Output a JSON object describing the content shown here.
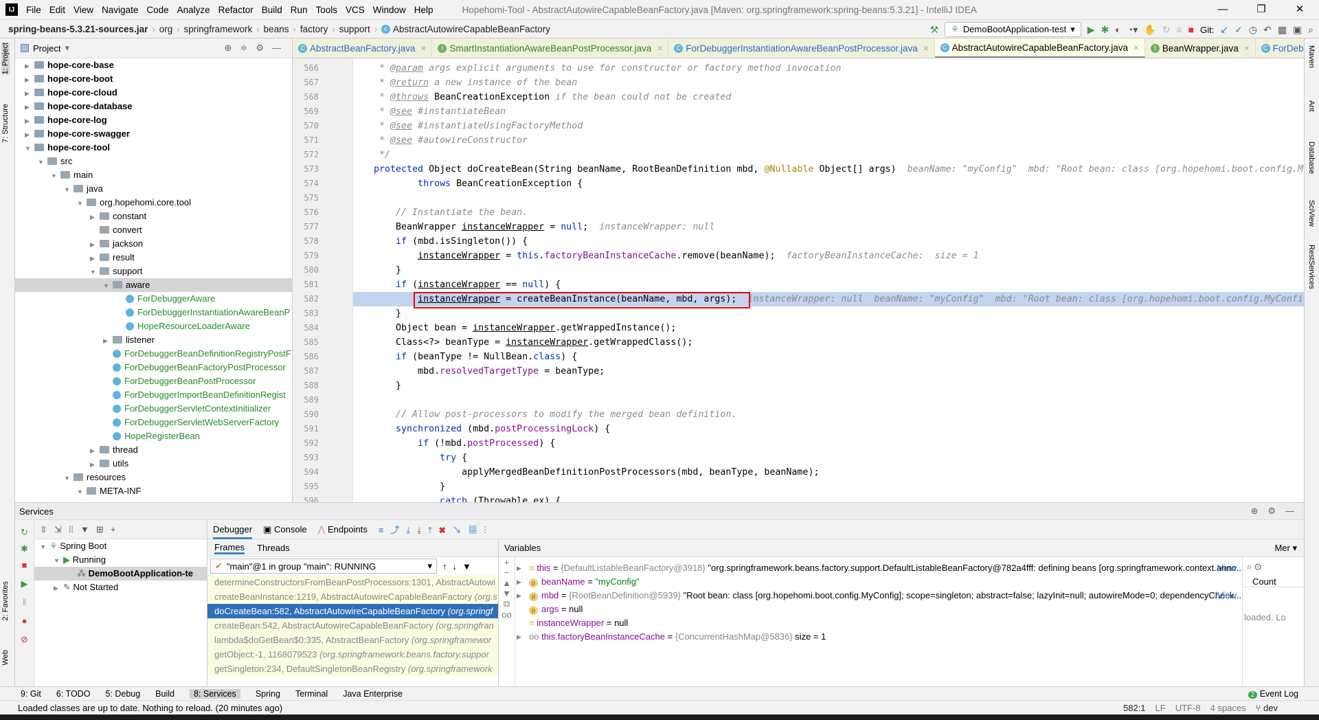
{
  "menubar": {
    "items": [
      "File",
      "Edit",
      "View",
      "Navigate",
      "Code",
      "Analyze",
      "Refactor",
      "Build",
      "Run",
      "Tools",
      "VCS",
      "Window",
      "Help"
    ],
    "title": "Hopehomi-Tool - AbstractAutowireCapableBeanFactory.java [Maven: org.springframework:spring-beans:5.3.21] - IntelliJ IDEA"
  },
  "breadcrumb": [
    "spring-beans-5.3.21-sources.jar",
    "org",
    "springframework",
    "beans",
    "factory",
    "support",
    "AbstractAutowireCapableBeanFactory"
  ],
  "run_config": "DemoBootApplication-test",
  "git_label": "Git:",
  "left_strip": [
    "1: Project",
    "7: Structure",
    "2: Favorites",
    "Web"
  ],
  "right_strip": [
    "Maven",
    "Ant",
    "Database",
    "SciView",
    "RestServices"
  ],
  "project": {
    "title": "Project",
    "tree": [
      {
        "label": "hope-core-base",
        "lvl": 0,
        "kind": "mod",
        "arrow": "▶"
      },
      {
        "label": "hope-core-boot",
        "lvl": 0,
        "kind": "mod",
        "arrow": "▶"
      },
      {
        "label": "hope-core-cloud",
        "lvl": 0,
        "kind": "mod",
        "arrow": "▶"
      },
      {
        "label": "hope-core-database",
        "lvl": 0,
        "kind": "mod",
        "arrow": "▶"
      },
      {
        "label": "hope-core-log",
        "lvl": 0,
        "kind": "mod",
        "arrow": "▶"
      },
      {
        "label": "hope-core-swagger",
        "lvl": 0,
        "kind": "mod",
        "arrow": "▶"
      },
      {
        "label": "hope-core-tool",
        "lvl": 0,
        "kind": "mod",
        "arrow": "▼"
      },
      {
        "label": "src",
        "lvl": 1,
        "kind": "folder",
        "arrow": "▼"
      },
      {
        "label": "main",
        "lvl": 2,
        "kind": "folder",
        "arrow": "▼"
      },
      {
        "label": "java",
        "lvl": 3,
        "kind": "folder",
        "arrow": "▼"
      },
      {
        "label": "org.hopehomi.core.tool",
        "lvl": 4,
        "kind": "folder",
        "arrow": "▼"
      },
      {
        "label": "constant",
        "lvl": 5,
        "kind": "folder",
        "arrow": "▶"
      },
      {
        "label": "convert",
        "lvl": 5,
        "kind": "folder",
        "arrow": ""
      },
      {
        "label": "jackson",
        "lvl": 5,
        "kind": "folder",
        "arrow": "▶"
      },
      {
        "label": "result",
        "lvl": 5,
        "kind": "folder",
        "arrow": "▶"
      },
      {
        "label": "support",
        "lvl": 5,
        "kind": "folder",
        "arrow": "▼"
      },
      {
        "label": "aware",
        "lvl": 6,
        "kind": "folder",
        "arrow": "▼",
        "selected": true
      },
      {
        "label": "ForDebuggerAware",
        "lvl": 7,
        "kind": "class",
        "arrow": ""
      },
      {
        "label": "ForDebuggerInstantiationAwareBeanP",
        "lvl": 7,
        "kind": "class",
        "arrow": ""
      },
      {
        "label": "HopeResourceLoaderAware",
        "lvl": 7,
        "kind": "class",
        "arrow": ""
      },
      {
        "label": "listener",
        "lvl": 6,
        "kind": "folder",
        "arrow": "▶"
      },
      {
        "label": "ForDebuggerBeanDefinitionRegistryPostF",
        "lvl": 6,
        "kind": "class",
        "arrow": ""
      },
      {
        "label": "ForDebuggerBeanFactoryPostProcessor",
        "lvl": 6,
        "kind": "class",
        "arrow": ""
      },
      {
        "label": "ForDebuggerBeanPostProcessor",
        "lvl": 6,
        "kind": "class",
        "arrow": ""
      },
      {
        "label": "ForDebuggerImportBeanDefinitionRegist",
        "lvl": 6,
        "kind": "class",
        "arrow": ""
      },
      {
        "label": "ForDebuggerServletContextInitializer",
        "lvl": 6,
        "kind": "class",
        "arrow": ""
      },
      {
        "label": "ForDebuggerServletWebServerFactory",
        "lvl": 6,
        "kind": "class",
        "arrow": ""
      },
      {
        "label": "HopeRegisterBean",
        "lvl": 6,
        "kind": "class",
        "arrow": ""
      },
      {
        "label": "thread",
        "lvl": 5,
        "kind": "folder",
        "arrow": "▶"
      },
      {
        "label": "utils",
        "lvl": 5,
        "kind": "folder",
        "arrow": "▶"
      },
      {
        "label": "resources",
        "lvl": 3,
        "kind": "folder",
        "arrow": "▼"
      },
      {
        "label": "META-INF",
        "lvl": 4,
        "kind": "folder",
        "arrow": "▼"
      }
    ]
  },
  "tabs": [
    {
      "label": "AbstractBeanFactory.java",
      "icon": "C",
      "color": "blue"
    },
    {
      "label": "SmartInstantiationAwareBeanPostProcessor.java",
      "icon": "I",
      "color": "green"
    },
    {
      "label": "ForDebuggerInstantiationAwareBeanPostProcessor.java",
      "icon": "C",
      "color": "blue"
    },
    {
      "label": "AbstractAutowireCapableBeanFactory.java",
      "icon": "C",
      "active": true
    },
    {
      "label": "BeanWrapper.java",
      "icon": "I"
    },
    {
      "label": "ForDebugge",
      "icon": "C",
      "color": "blue"
    }
  ],
  "editor": {
    "lines": [
      {
        "n": 566,
        "tokens": [
          [
            "    * ",
            "c"
          ],
          [
            "@param",
            "t"
          ],
          [
            " args explicit arguments to use for constructor or factory method invocation",
            "c"
          ]
        ]
      },
      {
        "n": 567,
        "tokens": [
          [
            "    * ",
            "c"
          ],
          [
            "@return",
            "t"
          ],
          [
            " a new instance of the bean",
            "c"
          ]
        ]
      },
      {
        "n": 568,
        "tokens": [
          [
            "    * ",
            "c"
          ],
          [
            "@throws",
            "t"
          ],
          [
            " BeanCreationException",
            "p"
          ],
          [
            " if the bean could not be created",
            "c"
          ]
        ]
      },
      {
        "n": 569,
        "tokens": [
          [
            "    * ",
            "c"
          ],
          [
            "@see",
            "t"
          ],
          [
            " #instantiateBean",
            "c"
          ]
        ]
      },
      {
        "n": 570,
        "tokens": [
          [
            "    * ",
            "c"
          ],
          [
            "@see",
            "t"
          ],
          [
            " #instantiateUsingFactoryMethod",
            "c"
          ]
        ]
      },
      {
        "n": 571,
        "tokens": [
          [
            "    * ",
            "c"
          ],
          [
            "@see",
            "t"
          ],
          [
            " #autowireConstructor",
            "c"
          ]
        ]
      },
      {
        "n": 572,
        "tokens": [
          [
            "    */",
            "c"
          ]
        ]
      },
      {
        "n": 573,
        "tokens": [
          [
            "   protected ",
            "k"
          ],
          [
            "Object ",
            "p"
          ],
          [
            "doCreateBean",
            "p"
          ],
          [
            "(String beanName, RootBeanDefinition mbd, ",
            "p"
          ],
          [
            "@Nullable",
            "a"
          ],
          [
            " Object[] args)",
            "p"
          ],
          [
            "  beanName: \"myConfig\"  mbd: \"Root bean: class [org.hopehomi.boot.config.M",
            "h"
          ]
        ]
      },
      {
        "n": 574,
        "tokens": [
          [
            "           throws ",
            "k"
          ],
          [
            "BeanCreationException {",
            "p"
          ]
        ]
      },
      {
        "n": 575,
        "tokens": []
      },
      {
        "n": 576,
        "tokens": [
          [
            "       // Instantiate the bean.",
            "c"
          ]
        ]
      },
      {
        "n": 577,
        "tokens": [
          [
            "       BeanWrapper ",
            "p"
          ],
          [
            "instanceWrapper",
            "u"
          ],
          [
            " = ",
            "p"
          ],
          [
            "null",
            "k"
          ],
          [
            ";",
            "p"
          ],
          [
            "  instanceWrapper: null",
            "h"
          ]
        ]
      },
      {
        "n": 578,
        "tokens": [
          [
            "       ",
            "p"
          ],
          [
            "if ",
            "k"
          ],
          [
            "(mbd.isSingleton()) {",
            "p"
          ]
        ]
      },
      {
        "n": 579,
        "tokens": [
          [
            "           ",
            "p"
          ],
          [
            "instanceWrapper",
            "u"
          ],
          [
            " = ",
            "p"
          ],
          [
            "this",
            "k"
          ],
          [
            ".",
            "p"
          ],
          [
            "factoryBeanInstanceCache",
            "f"
          ],
          [
            ".remove(beanName);",
            "p"
          ],
          [
            "  factoryBeanInstanceCache:  size = 1",
            "h"
          ]
        ]
      },
      {
        "n": 580,
        "tokens": [
          [
            "       }",
            "p"
          ]
        ]
      },
      {
        "n": 581,
        "tokens": [
          [
            "       ",
            "p"
          ],
          [
            "if ",
            "k"
          ],
          [
            "(",
            "p"
          ],
          [
            "instanceWrapper",
            "u"
          ],
          [
            " == ",
            "p"
          ],
          [
            "null",
            "k"
          ],
          [
            ") {",
            "p"
          ]
        ]
      },
      {
        "n": 582,
        "hl": true,
        "tokens": [
          [
            "           ",
            "p"
          ],
          [
            "instanceWrapper",
            "u"
          ],
          [
            " = createBeanInstance(beanName, mbd, args);",
            "p"
          ],
          [
            "  instanceWrapper: null  beanName: \"myConfig\"  mbd: \"Root bean: class [org.hopehomi.boot.config.MyConfi",
            "h"
          ]
        ]
      },
      {
        "n": 583,
        "tokens": [
          [
            "       }",
            "p"
          ]
        ]
      },
      {
        "n": 584,
        "tokens": [
          [
            "       Object bean = ",
            "p"
          ],
          [
            "instanceWrapper",
            "u"
          ],
          [
            ".getWrappedInstance();",
            "p"
          ]
        ]
      },
      {
        "n": 585,
        "tokens": [
          [
            "       Class<?> beanType = ",
            "p"
          ],
          [
            "instanceWrapper",
            "u"
          ],
          [
            ".getWrappedClass();",
            "p"
          ]
        ]
      },
      {
        "n": 586,
        "tokens": [
          [
            "       ",
            "p"
          ],
          [
            "if ",
            "k"
          ],
          [
            "(beanType != NullBean.",
            "p"
          ],
          [
            "class",
            "k"
          ],
          [
            ") {",
            "p"
          ]
        ]
      },
      {
        "n": 587,
        "tokens": [
          [
            "           mbd.",
            "p"
          ],
          [
            "resolvedTargetType",
            "f"
          ],
          [
            " = beanType;",
            "p"
          ]
        ]
      },
      {
        "n": 588,
        "tokens": [
          [
            "       }",
            "p"
          ]
        ]
      },
      {
        "n": 589,
        "tokens": []
      },
      {
        "n": 590,
        "tokens": [
          [
            "       // Allow post-processors to modify the merged bean definition.",
            "c"
          ]
        ]
      },
      {
        "n": 591,
        "tokens": [
          [
            "       ",
            "p"
          ],
          [
            "synchronized ",
            "k"
          ],
          [
            "(mbd.",
            "p"
          ],
          [
            "postProcessingLock",
            "f"
          ],
          [
            ") {",
            "p"
          ]
        ]
      },
      {
        "n": 592,
        "tokens": [
          [
            "           ",
            "p"
          ],
          [
            "if ",
            "k"
          ],
          [
            "(!mbd.",
            "p"
          ],
          [
            "postProcessed",
            "f"
          ],
          [
            ") {",
            "p"
          ]
        ]
      },
      {
        "n": 593,
        "tokens": [
          [
            "               ",
            "p"
          ],
          [
            "try ",
            "k"
          ],
          [
            "{",
            "p"
          ]
        ]
      },
      {
        "n": 594,
        "tokens": [
          [
            "                   applyMergedBeanDefinitionPostProcessors(mbd, beanType, beanName);",
            "p"
          ]
        ]
      },
      {
        "n": 595,
        "tokens": [
          [
            "               }",
            "p"
          ]
        ]
      },
      {
        "n": 596,
        "tokens": [
          [
            "               ",
            "p"
          ],
          [
            "catch ",
            "k"
          ],
          [
            "(Throwable ex) {",
            "p"
          ]
        ]
      }
    ]
  },
  "services": {
    "title": "Services",
    "tree": [
      {
        "label": "Spring Boot",
        "lvl": 0,
        "arrow": "▼"
      },
      {
        "label": "Running",
        "lvl": 1,
        "arrow": "▼"
      },
      {
        "label": "DemoBootApplication-te",
        "lvl": 2,
        "arrow": "",
        "selected": true
      },
      {
        "label": "Not Started",
        "lvl": 1,
        "arrow": "▶"
      }
    ]
  },
  "debugger": {
    "tabs": [
      "Debugger",
      "Console",
      "Endpoints"
    ],
    "frames_tabs": [
      "Frames",
      "Threads"
    ],
    "thread": "\"main\"@1 in group \"main\": RUNNING",
    "frames": [
      {
        "m": "determineConstructorsFromBeanPostProcessors:1301, AbstractAutowi",
        "p": ""
      },
      {
        "m": "createBeanInstance:1219, AbstractAutowireCapableBeanFactory ",
        "p": "(org.s"
      },
      {
        "m": "doCreateBean:582, AbstractAutowireCapableBeanFactory ",
        "p": "(org.springf",
        "selected": true
      },
      {
        "m": "createBean:542, AbstractAutowireCapableBeanFactory ",
        "p": "(org.springfran"
      },
      {
        "m": "lambda$doGetBean$0:335, AbstractBeanFactory ",
        "p": "(org.springframewor"
      },
      {
        "m": "getObject:-1, 1168079523 ",
        "p": "(org.springframework.beans.factory.suppor"
      },
      {
        "m": "getSingleton:234, DefaultSingletonBeanRegistry ",
        "p": "(org.springframework"
      }
    ],
    "variables_title": "Variables",
    "mem_label": "Mer",
    "count_label": "Count",
    "loaded_text": "loaded. Lo",
    "variables": [
      {
        "name": "this",
        "type": "{DefaultListableBeanFactory@3918}",
        "val": " \"org.springframework.beans.factory.support.DefaultListableBeanFactory@782a4fff: defining beans [org.springframework.context.anno...",
        "view": "View",
        "icon": "≡",
        "expand": true
      },
      {
        "name": "beanName",
        "type": "",
        "val": "\"myConfig\"",
        "str": true,
        "icon": "p",
        "expand": true
      },
      {
        "name": "mbd",
        "type": "{RootBeanDefinition@5939}",
        "val": " \"Root bean: class [org.hopehomi.boot.config.MyConfig]; scope=singleton; abstract=false; lazyInit=null; autowireMode=0; dependencyCheck...",
        "view": "View",
        "icon": "p",
        "expand": true
      },
      {
        "name": "args",
        "type": "",
        "val": "null",
        "icon": "p"
      },
      {
        "name": "instanceWrapper",
        "type": "",
        "val": "null",
        "icon": "≡"
      },
      {
        "name": "this.factoryBeanInstanceCache",
        "type": "{ConcurrentHashMap@5836}",
        "val": "  size = 1",
        "icon": "oo",
        "expand": true
      }
    ]
  },
  "bottom_tabs": [
    "9: Git",
    "6: TODO",
    "5: Debug",
    "Build",
    "8: Services",
    "Spring",
    "Terminal",
    "Java Enterprise"
  ],
  "event_log": {
    "count": "2",
    "label": "Event Log"
  },
  "status": {
    "message": "Loaded classes are up to date. Nothing to reload. (20 minutes ago)",
    "position": "582:1",
    "line_sep": "LF",
    "encoding": "UTF-8",
    "indent": "4 spaces",
    "branch": "dev"
  }
}
